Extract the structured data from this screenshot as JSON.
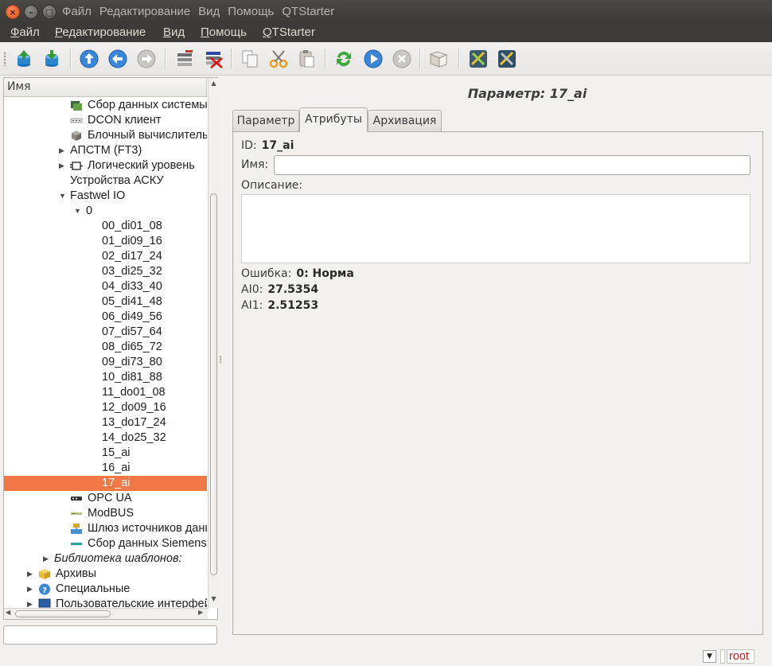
{
  "window": {
    "title_overlay": [
      "Файл",
      "Редактирование",
      "Вид",
      "Помощь",
      "QTStarter"
    ]
  },
  "menubar": {
    "items": [
      "Файл",
      "Редактирование",
      "Вид",
      "Помощь",
      "QTStarter"
    ]
  },
  "toolbar": {
    "icons": [
      "db-load-icon",
      "db-save-icon",
      "up-icon",
      "back-icon",
      "forward-icon",
      "item-add-icon",
      "item-delete-icon",
      "copy-icon",
      "cut-icon",
      "paste-icon",
      "refresh-icon",
      "start-icon",
      "stop-icon",
      "manual-icon",
      "tool-a-icon",
      "tool-b-icon"
    ]
  },
  "tree": {
    "header": "Имя",
    "rows": [
      {
        "label": "Сбор данных системы"
      },
      {
        "label": "DCON клиент"
      },
      {
        "label": "Блочный вычислитель"
      },
      {
        "label": "АПСТМ (FT3)"
      },
      {
        "label": "Логический уровень"
      },
      {
        "label": "Устройства АСКУ"
      },
      {
        "label": "Fastwel IO"
      },
      {
        "label": "0"
      },
      {
        "label": "00_di01_08"
      },
      {
        "label": "01_di09_16"
      },
      {
        "label": "02_di17_24"
      },
      {
        "label": "03_di25_32"
      },
      {
        "label": "04_di33_40"
      },
      {
        "label": "05_di41_48"
      },
      {
        "label": "06_di49_56"
      },
      {
        "label": "07_di57_64"
      },
      {
        "label": "08_di65_72"
      },
      {
        "label": "09_di73_80"
      },
      {
        "label": "10_di81_88"
      },
      {
        "label": "11_do01_08"
      },
      {
        "label": "12_do09_16"
      },
      {
        "label": "13_do17_24"
      },
      {
        "label": "14_do25_32"
      },
      {
        "label": "15_ai"
      },
      {
        "label": "16_ai"
      },
      {
        "label": "17_ai"
      },
      {
        "label": "OPC UA"
      },
      {
        "label": "ModBUS"
      },
      {
        "label": "Шлюз источников данных"
      },
      {
        "label": "Сбор данных Siemens"
      },
      {
        "label": "Библиотека шаблонов:"
      },
      {
        "label": "Архивы"
      },
      {
        "label": "Специальные"
      },
      {
        "label": "Пользовательские интерфейсы"
      }
    ],
    "filter_value": ""
  },
  "panel": {
    "title": "Параметр: 17_ai",
    "tabs": [
      "Параметр",
      "Атрибуты",
      "Архивация"
    ],
    "active_tab": "Атрибуты",
    "id_label": "ID:",
    "id_value": "17_ai",
    "name_label": "Имя:",
    "name_value": "",
    "desc_label": "Описание:",
    "desc_value": "",
    "error_label": "Ошибка:",
    "error_value": "0: Норма",
    "ai0_label": "AI0:",
    "ai0_value": "27.5354",
    "ai1_label": "AI1:",
    "ai1_value": "2.51253"
  },
  "statusbar": {
    "user": "root"
  },
  "colors": {
    "selection": "#f07746",
    "titlebar": "#3c3b37",
    "user_text": "#e01515"
  }
}
